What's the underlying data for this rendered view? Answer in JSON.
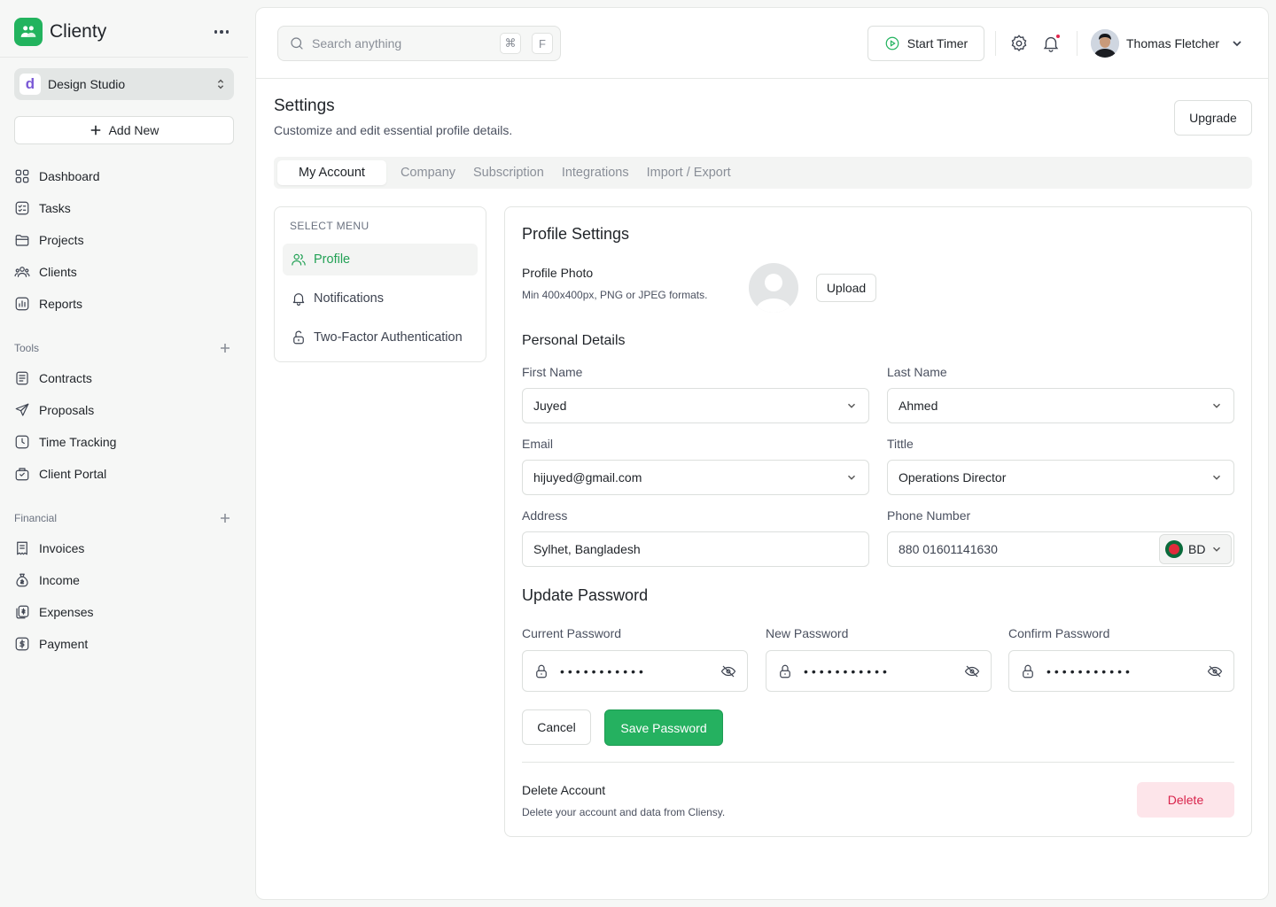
{
  "brand": {
    "name": "Clienty",
    "color": "#22b35e"
  },
  "workspace": {
    "initial": "d",
    "name": "Design Studio"
  },
  "sidebar": {
    "add_new": "Add New",
    "main_items": [
      {
        "label": "Dashboard",
        "icon": "grid-icon"
      },
      {
        "label": "Tasks",
        "icon": "checklist-icon"
      },
      {
        "label": "Projects",
        "icon": "folder-icon"
      },
      {
        "label": "Clients",
        "icon": "users-icon"
      },
      {
        "label": "Reports",
        "icon": "chart-icon"
      }
    ],
    "tools_label": "Tools",
    "tools_items": [
      {
        "label": "Contracts",
        "icon": "document-icon"
      },
      {
        "label": "Proposals",
        "icon": "send-icon"
      },
      {
        "label": "Time Tracking",
        "icon": "clock-icon"
      },
      {
        "label": "Client Portal",
        "icon": "portal-icon"
      }
    ],
    "financial_label": "Financial",
    "financial_items": [
      {
        "label": "Invoices",
        "icon": "invoice-icon"
      },
      {
        "label": "Income",
        "icon": "money-bag-icon"
      },
      {
        "label": "Expenses",
        "icon": "expense-icon"
      },
      {
        "label": "Payment",
        "icon": "dollar-icon"
      }
    ]
  },
  "topbar": {
    "search_placeholder": "Search anything",
    "shortcut_cmd": "⌘",
    "shortcut_key": "F",
    "timer_label": "Start Timer",
    "user_name": "Thomas Fletcher"
  },
  "page": {
    "title": "Settings",
    "subtitle": "Customize and edit essential profile details.",
    "upgrade_label": "Upgrade",
    "tabs": [
      "My Account",
      "Company",
      "Subscription",
      "Integrations",
      "Import / Export"
    ]
  },
  "menu": {
    "heading": "SELECT MENU",
    "items": [
      "Profile",
      "Notifications",
      "Two-Factor Authentication"
    ]
  },
  "profile": {
    "title": "Profile Settings",
    "photo_label": "Profile Photo",
    "photo_hint": "Min 400x400px, PNG or JPEG formats.",
    "upload_label": "Upload",
    "personal_title": "Personal Details",
    "first_name_label": "First Name",
    "first_name": "Juyed",
    "last_name_label": "Last Name",
    "last_name": "Ahmed",
    "email_label": "Email",
    "email": "hijuyed@gmail.com",
    "title_label": "Tittle",
    "title_value": "Operations Director",
    "address_label": "Address",
    "address": "Sylhet, Bangladesh",
    "phone_label": "Phone Number",
    "phone": "880 01601141630",
    "country_code": "BD"
  },
  "password": {
    "title": "Update Password",
    "current_label": "Current Password",
    "new_label": "New Password",
    "confirm_label": "Confirm Password",
    "masked": "•••••••••••",
    "cancel_label": "Cancel",
    "save_label": "Save Password"
  },
  "delete": {
    "title": "Delete Account",
    "subtitle": "Delete your account and data from Cliensy.",
    "button_label": "Delete"
  },
  "colors": {
    "accent": "#22b35e",
    "danger": "#d9234b",
    "danger_bg": "#fde5ea"
  }
}
